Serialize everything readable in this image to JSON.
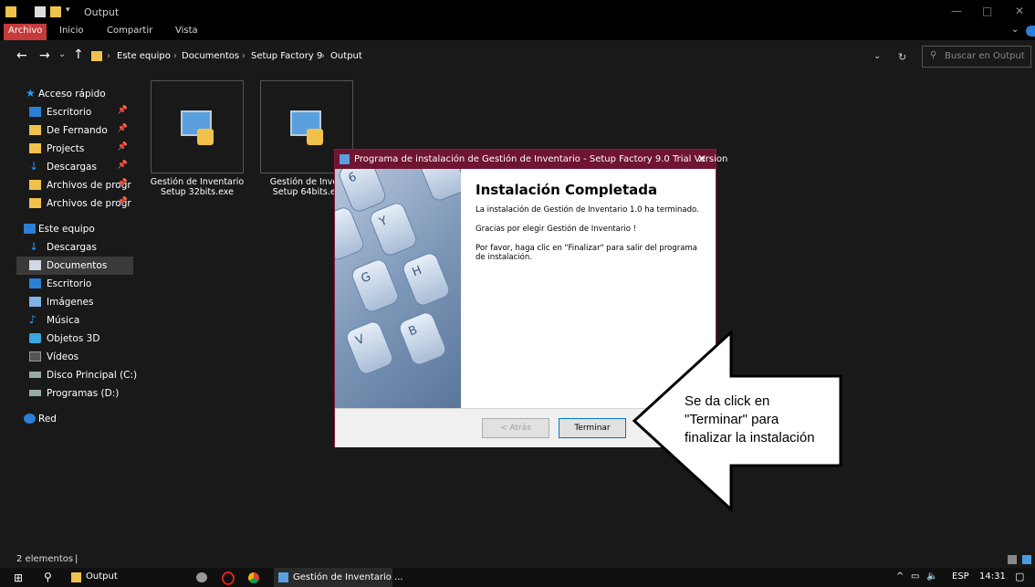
{
  "window": {
    "title": "Output",
    "controls": {
      "minimize": "—",
      "maximize": "□",
      "close": "✕"
    }
  },
  "ribbon": {
    "tabs": [
      "Archivo",
      "Inicio",
      "Compartir",
      "Vista"
    ]
  },
  "address": {
    "crumbs": [
      "Este equipo",
      "Documentos",
      "Setup Factory 9",
      "Output"
    ],
    "search_placeholder": "Buscar en Output"
  },
  "sidebar": {
    "quick_access": "Acceso rápido",
    "pinned": [
      "Escritorio",
      "De Fernando",
      "Projects",
      "Descargas",
      "Archivos de progr",
      "Archivos de progr"
    ],
    "this_pc": "Este equipo",
    "pc_items": [
      "Descargas",
      "Documentos",
      "Escritorio",
      "Imágenes",
      "Música",
      "Objetos 3D",
      "Vídeos",
      "Disco Principal (C:)",
      "Programas (D:)"
    ],
    "network": "Red"
  },
  "files": [
    {
      "name_line1": "Gestión de Inventario",
      "name_line2": "Setup 32bits.exe"
    },
    {
      "name_line1": "Gestión de Inven",
      "name_line2": "Setup 64bits.ex"
    }
  ],
  "status": {
    "items_count": "2 elementos"
  },
  "dialog": {
    "title": "Programa de instalación de Gestión de Inventario - Setup Factory 9.0 Trial Version",
    "heading": "Instalación Completada",
    "line1": "La instalación de Gestión de Inventario 1.0 ha terminado.",
    "line2": "Gracias por elegir Gestión de Inventario !",
    "line3": "Por favor, haga clic en \"Finalizar\" para salir del programa de instalación.",
    "back_button": "< Atrás",
    "finish_button": "Terminar",
    "image_keys": [
      "6",
      "T",
      "Y",
      "G",
      "H",
      "V",
      "B"
    ]
  },
  "callout": {
    "text_line1": "Se da click en",
    "text_line2": "\"Terminar\" para",
    "text_line3": "finalizar la instalación"
  },
  "taskbar": {
    "explorer_label": "Output",
    "installer_label": "Gestión de Inventario ...",
    "lang": "ESP",
    "time": "14:31"
  },
  "colors": {
    "accent": "#c53b3b",
    "dialog_title": "#6f1531",
    "folder": "#f0c24c",
    "drive_blue": "#2b7fd4"
  }
}
